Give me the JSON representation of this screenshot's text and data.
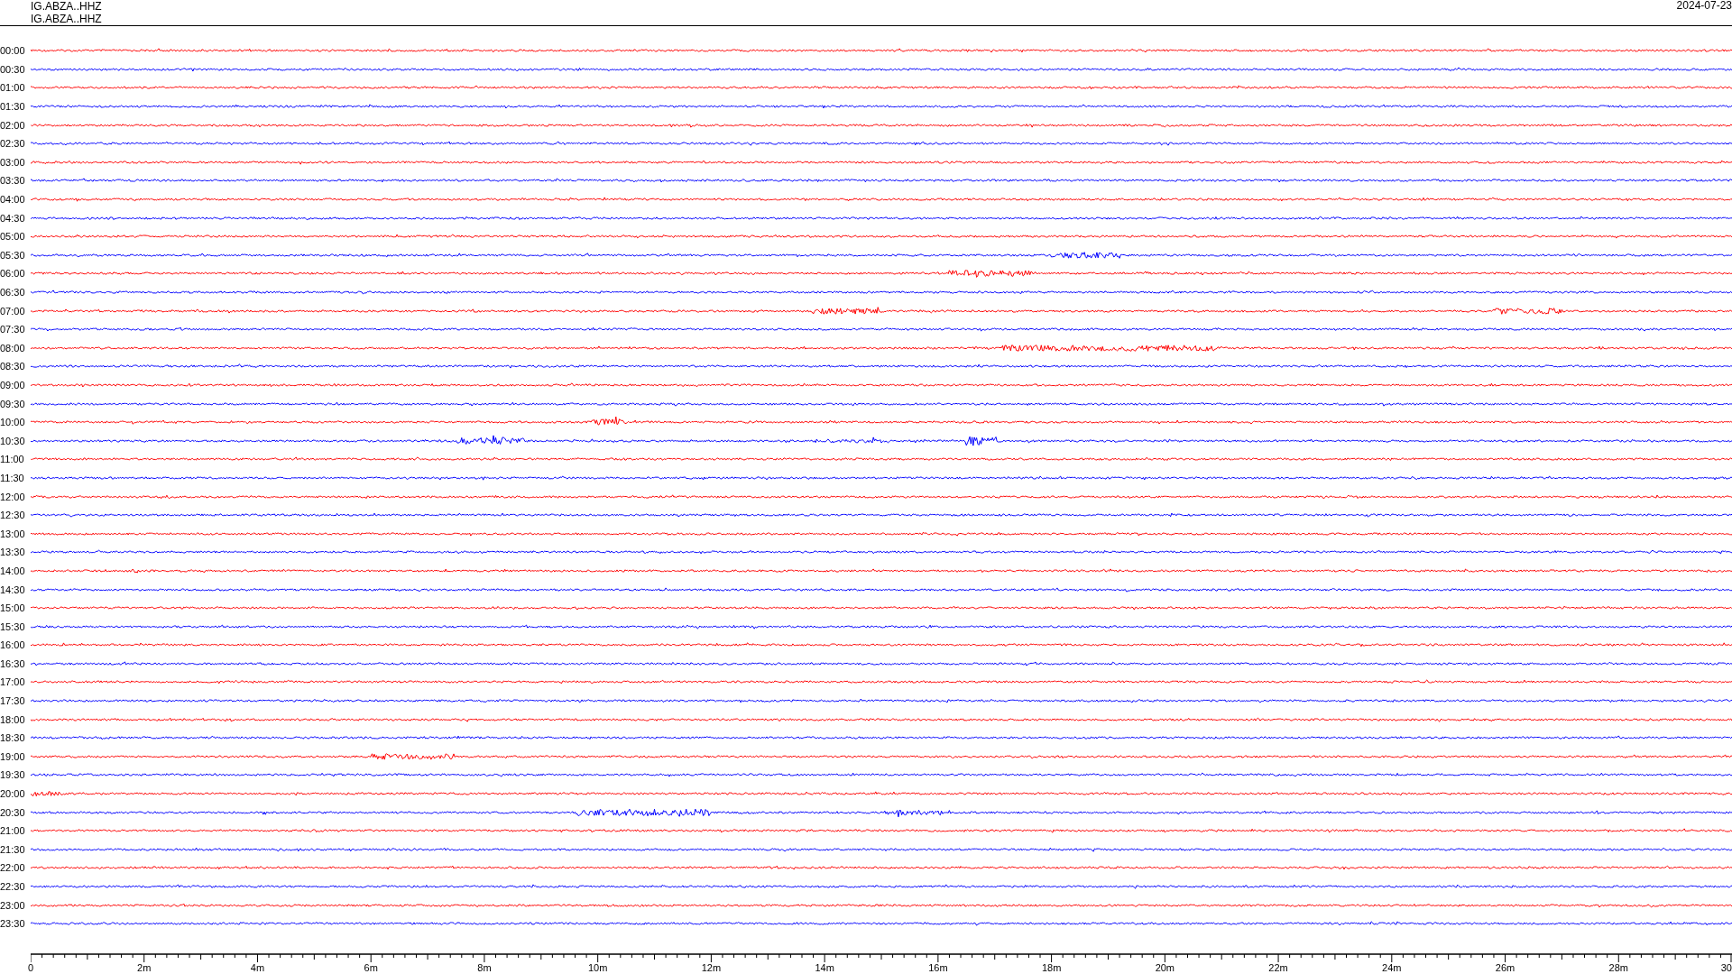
{
  "header": {
    "station_lines": [
      "IG.ABZA..HHZ",
      "IG.ABZA..HHZ"
    ],
    "date": "2024-07-23"
  },
  "traces": [
    {
      "time": "00:00",
      "color": "#ff0000"
    },
    {
      "time": "00:30",
      "color": "#0000ff"
    },
    {
      "time": "01:00",
      "color": "#ff0000"
    },
    {
      "time": "01:30",
      "color": "#0000ff"
    },
    {
      "time": "02:00",
      "color": "#ff0000"
    },
    {
      "time": "02:30",
      "color": "#0000ff"
    },
    {
      "time": "03:00",
      "color": "#ff0000"
    },
    {
      "time": "03:30",
      "color": "#0000ff"
    },
    {
      "time": "04:00",
      "color": "#ff0000"
    },
    {
      "time": "04:30",
      "color": "#0000ff"
    },
    {
      "time": "05:00",
      "color": "#ff0000"
    },
    {
      "time": "05:30",
      "color": "#0000ff"
    },
    {
      "time": "06:00",
      "color": "#ff0000"
    },
    {
      "time": "06:30",
      "color": "#0000ff"
    },
    {
      "time": "07:00",
      "color": "#ff0000"
    },
    {
      "time": "07:30",
      "color": "#0000ff"
    },
    {
      "time": "08:00",
      "color": "#ff0000"
    },
    {
      "time": "08:30",
      "color": "#0000ff"
    },
    {
      "time": "09:00",
      "color": "#ff0000"
    },
    {
      "time": "09:30",
      "color": "#0000ff"
    },
    {
      "time": "10:00",
      "color": "#ff0000"
    },
    {
      "time": "10:30",
      "color": "#0000ff"
    },
    {
      "time": "11:00",
      "color": "#ff0000"
    },
    {
      "time": "11:30",
      "color": "#0000ff"
    },
    {
      "time": "12:00",
      "color": "#ff0000"
    },
    {
      "time": "12:30",
      "color": "#0000ff"
    },
    {
      "time": "13:00",
      "color": "#ff0000"
    },
    {
      "time": "13:30",
      "color": "#0000ff"
    },
    {
      "time": "14:00",
      "color": "#ff0000"
    },
    {
      "time": "14:30",
      "color": "#0000ff"
    },
    {
      "time": "15:00",
      "color": "#ff0000"
    },
    {
      "time": "15:30",
      "color": "#0000ff"
    },
    {
      "time": "16:00",
      "color": "#ff0000"
    },
    {
      "time": "16:30",
      "color": "#0000ff"
    },
    {
      "time": "17:00",
      "color": "#ff0000"
    },
    {
      "time": "17:30",
      "color": "#0000ff"
    },
    {
      "time": "18:00",
      "color": "#ff0000"
    },
    {
      "time": "18:30",
      "color": "#0000ff"
    },
    {
      "time": "19:00",
      "color": "#ff0000"
    },
    {
      "time": "19:30",
      "color": "#0000ff"
    },
    {
      "time": "20:00",
      "color": "#ff0000"
    },
    {
      "time": "20:30",
      "color": "#0000ff"
    },
    {
      "time": "21:00",
      "color": "#ff0000"
    },
    {
      "time": "21:30",
      "color": "#0000ff"
    },
    {
      "time": "22:00",
      "color": "#ff0000"
    },
    {
      "time": "22:30",
      "color": "#0000ff"
    },
    {
      "time": "23:00",
      "color": "#ff0000"
    },
    {
      "time": "23:30",
      "color": "#0000ff"
    }
  ],
  "time_axis": {
    "labels": [
      "0",
      "2m",
      "4m",
      "6m",
      "8m",
      "10m",
      "12m",
      "14m",
      "16m",
      "18m",
      "20m",
      "22m",
      "24m",
      "26m",
      "28m",
      "30"
    ]
  }
}
